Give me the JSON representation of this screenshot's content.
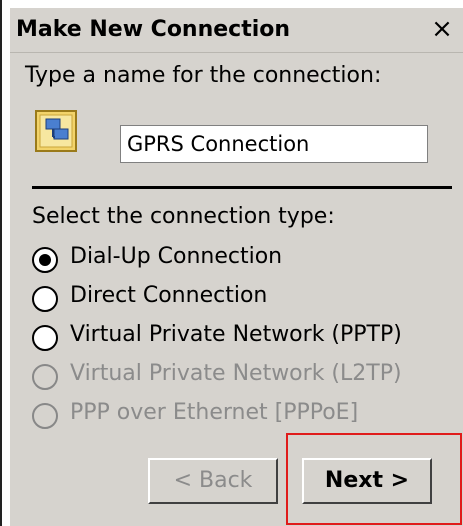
{
  "dialog": {
    "title": "Make New Connection",
    "close_glyph": "×",
    "name_prompt": "Type a name for the connection:",
    "connection_name": "GPRS Connection",
    "type_prompt": "Select the connection type:",
    "options": [
      {
        "label": "Dial-Up Connection",
        "selected": true,
        "enabled": true
      },
      {
        "label": "Direct Connection",
        "selected": false,
        "enabled": true
      },
      {
        "label": "Virtual Private Network (PPTP)",
        "selected": false,
        "enabled": true
      },
      {
        "label": "Virtual Private Network (L2TP)",
        "selected": false,
        "enabled": false
      },
      {
        "label": "PPP over Ethernet [PPPoE]",
        "selected": false,
        "enabled": false
      }
    ],
    "buttons": {
      "back": "< Back",
      "next": "Next >"
    },
    "icon": "network-connection-icon",
    "highlight_color": "#e01b1b"
  }
}
